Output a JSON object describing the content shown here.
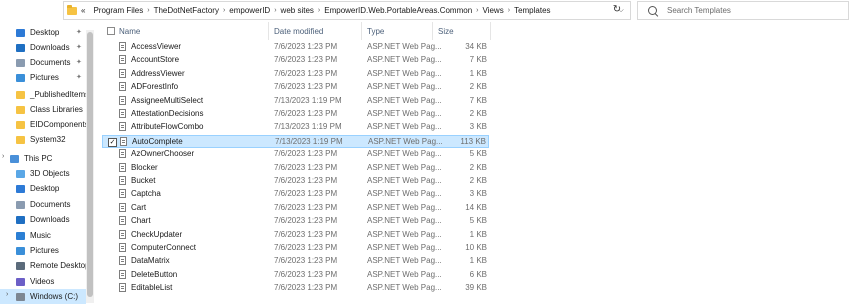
{
  "address": {
    "overflow": "«",
    "crumbs": [
      "Program Files",
      "TheDotNetFactory",
      "empowerID",
      "web sites",
      "EmpowerID.Web.PortableAreas.Common",
      "Views",
      "Templates"
    ]
  },
  "search": {
    "placeholder": "Search Templates"
  },
  "nav": {
    "items": [
      {
        "label": "Desktop",
        "icon": "desktop-icon",
        "pinned": true
      },
      {
        "label": "Downloads",
        "icon": "downloads-icon",
        "pinned": true
      },
      {
        "label": "Documents",
        "icon": "documents-icon",
        "pinned": true
      },
      {
        "label": "Pictures",
        "icon": "pictures-icon",
        "pinned": true
      },
      {
        "label": "_PublishedItems",
        "icon": "folder-icon",
        "pinned": false
      },
      {
        "label": "Class Libraries",
        "icon": "folder-icon",
        "pinned": false
      },
      {
        "label": "EIDComponents",
        "icon": "folder-icon",
        "pinned": false
      },
      {
        "label": "System32",
        "icon": "folder-icon",
        "pinned": false
      },
      {
        "label": "This PC",
        "icon": "this-pc-icon",
        "pinned": false
      },
      {
        "label": "3D Objects",
        "icon": "3d-objects-icon",
        "pinned": false
      },
      {
        "label": "Desktop",
        "icon": "desktop-icon",
        "pinned": false
      },
      {
        "label": "Documents",
        "icon": "documents-icon",
        "pinned": false
      },
      {
        "label": "Downloads",
        "icon": "downloads-icon",
        "pinned": false
      },
      {
        "label": "Music",
        "icon": "music-icon",
        "pinned": false
      },
      {
        "label": "Pictures",
        "icon": "pictures-icon",
        "pinned": false
      },
      {
        "label": "Remote Desktop",
        "icon": "remote-desktop-icon",
        "pinned": false
      },
      {
        "label": "Videos",
        "icon": "videos-icon",
        "pinned": false
      },
      {
        "label": "Windows (C:)",
        "icon": "drive-icon",
        "pinned": false
      }
    ]
  },
  "columns": {
    "name": "Name",
    "date": "Date modified",
    "type": "Type",
    "size": "Size"
  },
  "files": [
    {
      "name": "AccessViewer",
      "date": "7/6/2023 1:23 PM",
      "type": "ASP.NET Web Pag...",
      "size": "34 KB"
    },
    {
      "name": "AccountStore",
      "date": "7/6/2023 1:23 PM",
      "type": "ASP.NET Web Pag...",
      "size": "7 KB"
    },
    {
      "name": "AddressViewer",
      "date": "7/6/2023 1:23 PM",
      "type": "ASP.NET Web Pag...",
      "size": "1 KB"
    },
    {
      "name": "ADForestInfo",
      "date": "7/6/2023 1:23 PM",
      "type": "ASP.NET Web Pag...",
      "size": "2 KB"
    },
    {
      "name": "AssigneeMultiSelect",
      "date": "7/13/2023 1:19 PM",
      "type": "ASP.NET Web Pag...",
      "size": "7 KB"
    },
    {
      "name": "AttestationDecisions",
      "date": "7/6/2023 1:23 PM",
      "type": "ASP.NET Web Pag...",
      "size": "2 KB"
    },
    {
      "name": "AttributeFlowCombo",
      "date": "7/13/2023 1:19 PM",
      "type": "ASP.NET Web Pag...",
      "size": "3 KB"
    },
    {
      "name": "AutoComplete",
      "date": "7/13/2023 1:19 PM",
      "type": "ASP.NET Web Pag...",
      "size": "113 KB"
    },
    {
      "name": "AzOwnerChooser",
      "date": "7/6/2023 1:23 PM",
      "type": "ASP.NET Web Pag...",
      "size": "5 KB"
    },
    {
      "name": "Blocker",
      "date": "7/6/2023 1:23 PM",
      "type": "ASP.NET Web Pag...",
      "size": "2 KB"
    },
    {
      "name": "Bucket",
      "date": "7/6/2023 1:23 PM",
      "type": "ASP.NET Web Pag...",
      "size": "2 KB"
    },
    {
      "name": "Captcha",
      "date": "7/6/2023 1:23 PM",
      "type": "ASP.NET Web Pag...",
      "size": "3 KB"
    },
    {
      "name": "Cart",
      "date": "7/6/2023 1:23 PM",
      "type": "ASP.NET Web Pag...",
      "size": "14 KB"
    },
    {
      "name": "Chart",
      "date": "7/6/2023 1:23 PM",
      "type": "ASP.NET Web Pag...",
      "size": "5 KB"
    },
    {
      "name": "CheckUpdater",
      "date": "7/6/2023 1:23 PM",
      "type": "ASP.NET Web Pag...",
      "size": "1 KB"
    },
    {
      "name": "ComputerConnect",
      "date": "7/6/2023 1:23 PM",
      "type": "ASP.NET Web Pag...",
      "size": "10 KB"
    },
    {
      "name": "DataMatrix",
      "date": "7/6/2023 1:23 PM",
      "type": "ASP.NET Web Pag...",
      "size": "1 KB"
    },
    {
      "name": "DeleteButton",
      "date": "7/6/2023 1:23 PM",
      "type": "ASP.NET Web Pag...",
      "size": "6 KB"
    },
    {
      "name": "EditableList",
      "date": "7/6/2023 1:23 PM",
      "type": "ASP.NET Web Pag...",
      "size": "39 KB"
    }
  ],
  "selected_file": "AutoComplete",
  "colors": {
    "selection": "#cce8ff",
    "selection_border": "#99d1ff",
    "folder": "#f6c343"
  }
}
